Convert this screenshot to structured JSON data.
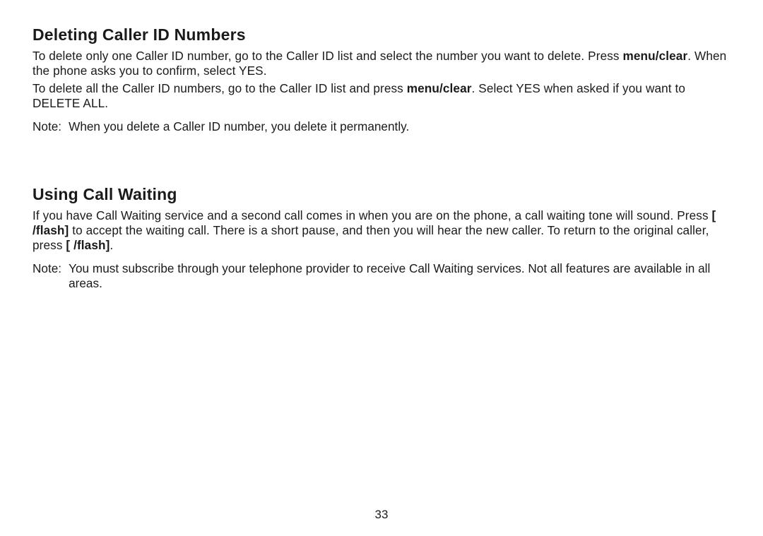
{
  "section1": {
    "heading": "Deleting Caller ID Numbers",
    "p1a": "To delete only one Caller ID number, go to the Caller ID list and select the number you want to delete. Press ",
    "p1b_bold": "menu/clear",
    "p1c": ". When the phone asks you to confirm, select YES.",
    "p2a": "To delete all the Caller ID numbers, go to the Caller ID list and press ",
    "p2b_bold": "menu/clear",
    "p2c": ". Select YES when asked if you want to DELETE ALL.",
    "note_label": "Note:",
    "note_body": "When you delete a Caller ID number, you delete it permanently."
  },
  "section2": {
    "heading": "Using Call Waiting",
    "p1a": "If you have Call Waiting service and a second call comes in when you are on the phone, a call waiting tone will sound. Press ",
    "p1b_bold": "[ /flash]",
    "p1c": " to accept the waiting call. There is a short pause, and then you will hear the new caller. To return to the original caller, press ",
    "p1d_bold": "[ /flash]",
    "p1e": ".",
    "note_label": "Note:",
    "note_body": "You must subscribe through your telephone provider to receive Call Waiting services. Not all features are available in all areas."
  },
  "page_number": "33"
}
